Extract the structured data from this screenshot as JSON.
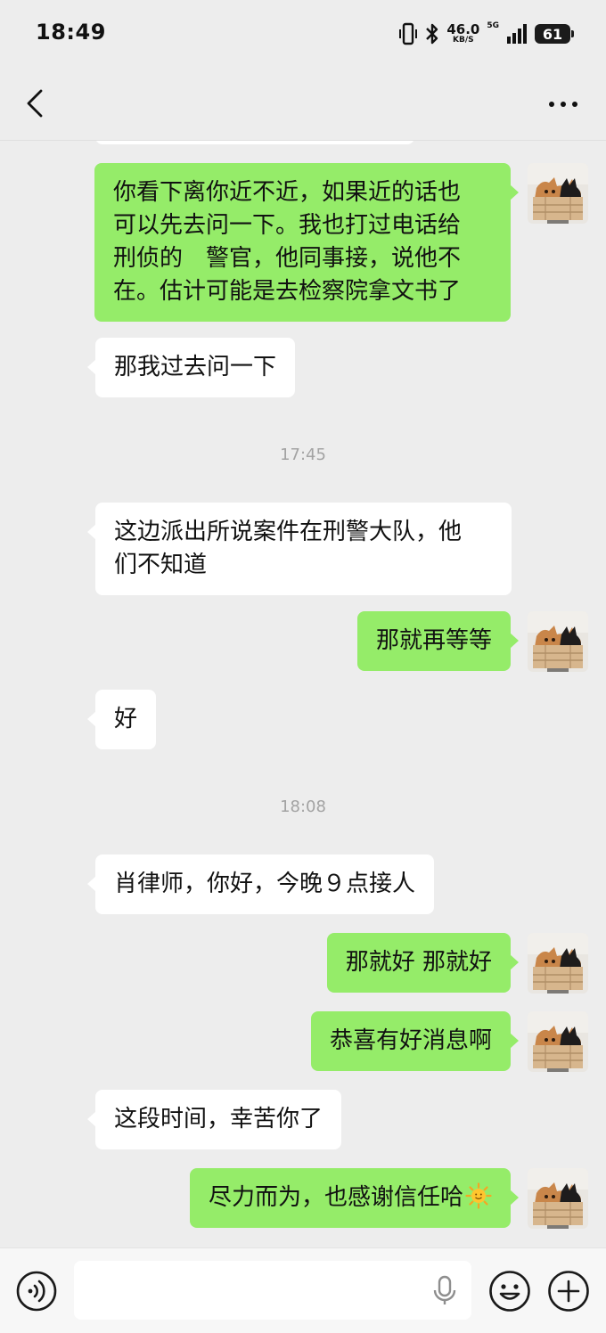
{
  "status_bar": {
    "time": "18:49",
    "net_speed": "46.0",
    "net_unit": "KB/S",
    "net_type": "5G",
    "battery": "61"
  },
  "nav": {
    "title": "",
    "back_icon": "chevron-left-icon",
    "more_icon": "more-horizontal-icon"
  },
  "messages": [
    {
      "side": "out",
      "lines": [
        "你看下离你近不近，如果近的话也",
        "可以先去问一下。我也打过电话给",
        "刑侦的　警官，他同事接，说他不",
        "在。估计可能是去检察院拿文书了"
      ]
    },
    {
      "side": "in",
      "lines": [
        "那我过去问一下"
      ]
    },
    {
      "type": "time",
      "text": "17:45"
    },
    {
      "side": "in",
      "lines": [
        "这边派出所说案件在刑警大队，他",
        "们不知道"
      ]
    },
    {
      "side": "out",
      "lines": [
        "那就再等等"
      ]
    },
    {
      "side": "in",
      "lines": [
        "好"
      ]
    },
    {
      "type": "time",
      "text": "18:08"
    },
    {
      "side": "in",
      "lines": [
        "肖律师，你好，今晚９点接人"
      ]
    },
    {
      "side": "out",
      "lines": [
        "那就好 那就好"
      ]
    },
    {
      "side": "out",
      "lines": [
        "恭喜有好消息啊"
      ]
    },
    {
      "side": "in",
      "lines": [
        "这段时间，幸苦你了"
      ]
    },
    {
      "side": "out",
      "lines": [
        "尽力而为，也感谢信任哈"
      ],
      "emoji": "sun-emoji"
    }
  ],
  "input_bar": {
    "voice_icon": "voice-mode-icon",
    "mic_icon": "microphone-icon",
    "emoji_icon": "smiley-icon",
    "plus_icon": "plus-circle-icon",
    "placeholder": ""
  },
  "colors": {
    "background": "#ededed",
    "outgoing_bubble": "#95ec69",
    "incoming_bubble": "#ffffff",
    "timestamp": "#a3a3a3"
  }
}
